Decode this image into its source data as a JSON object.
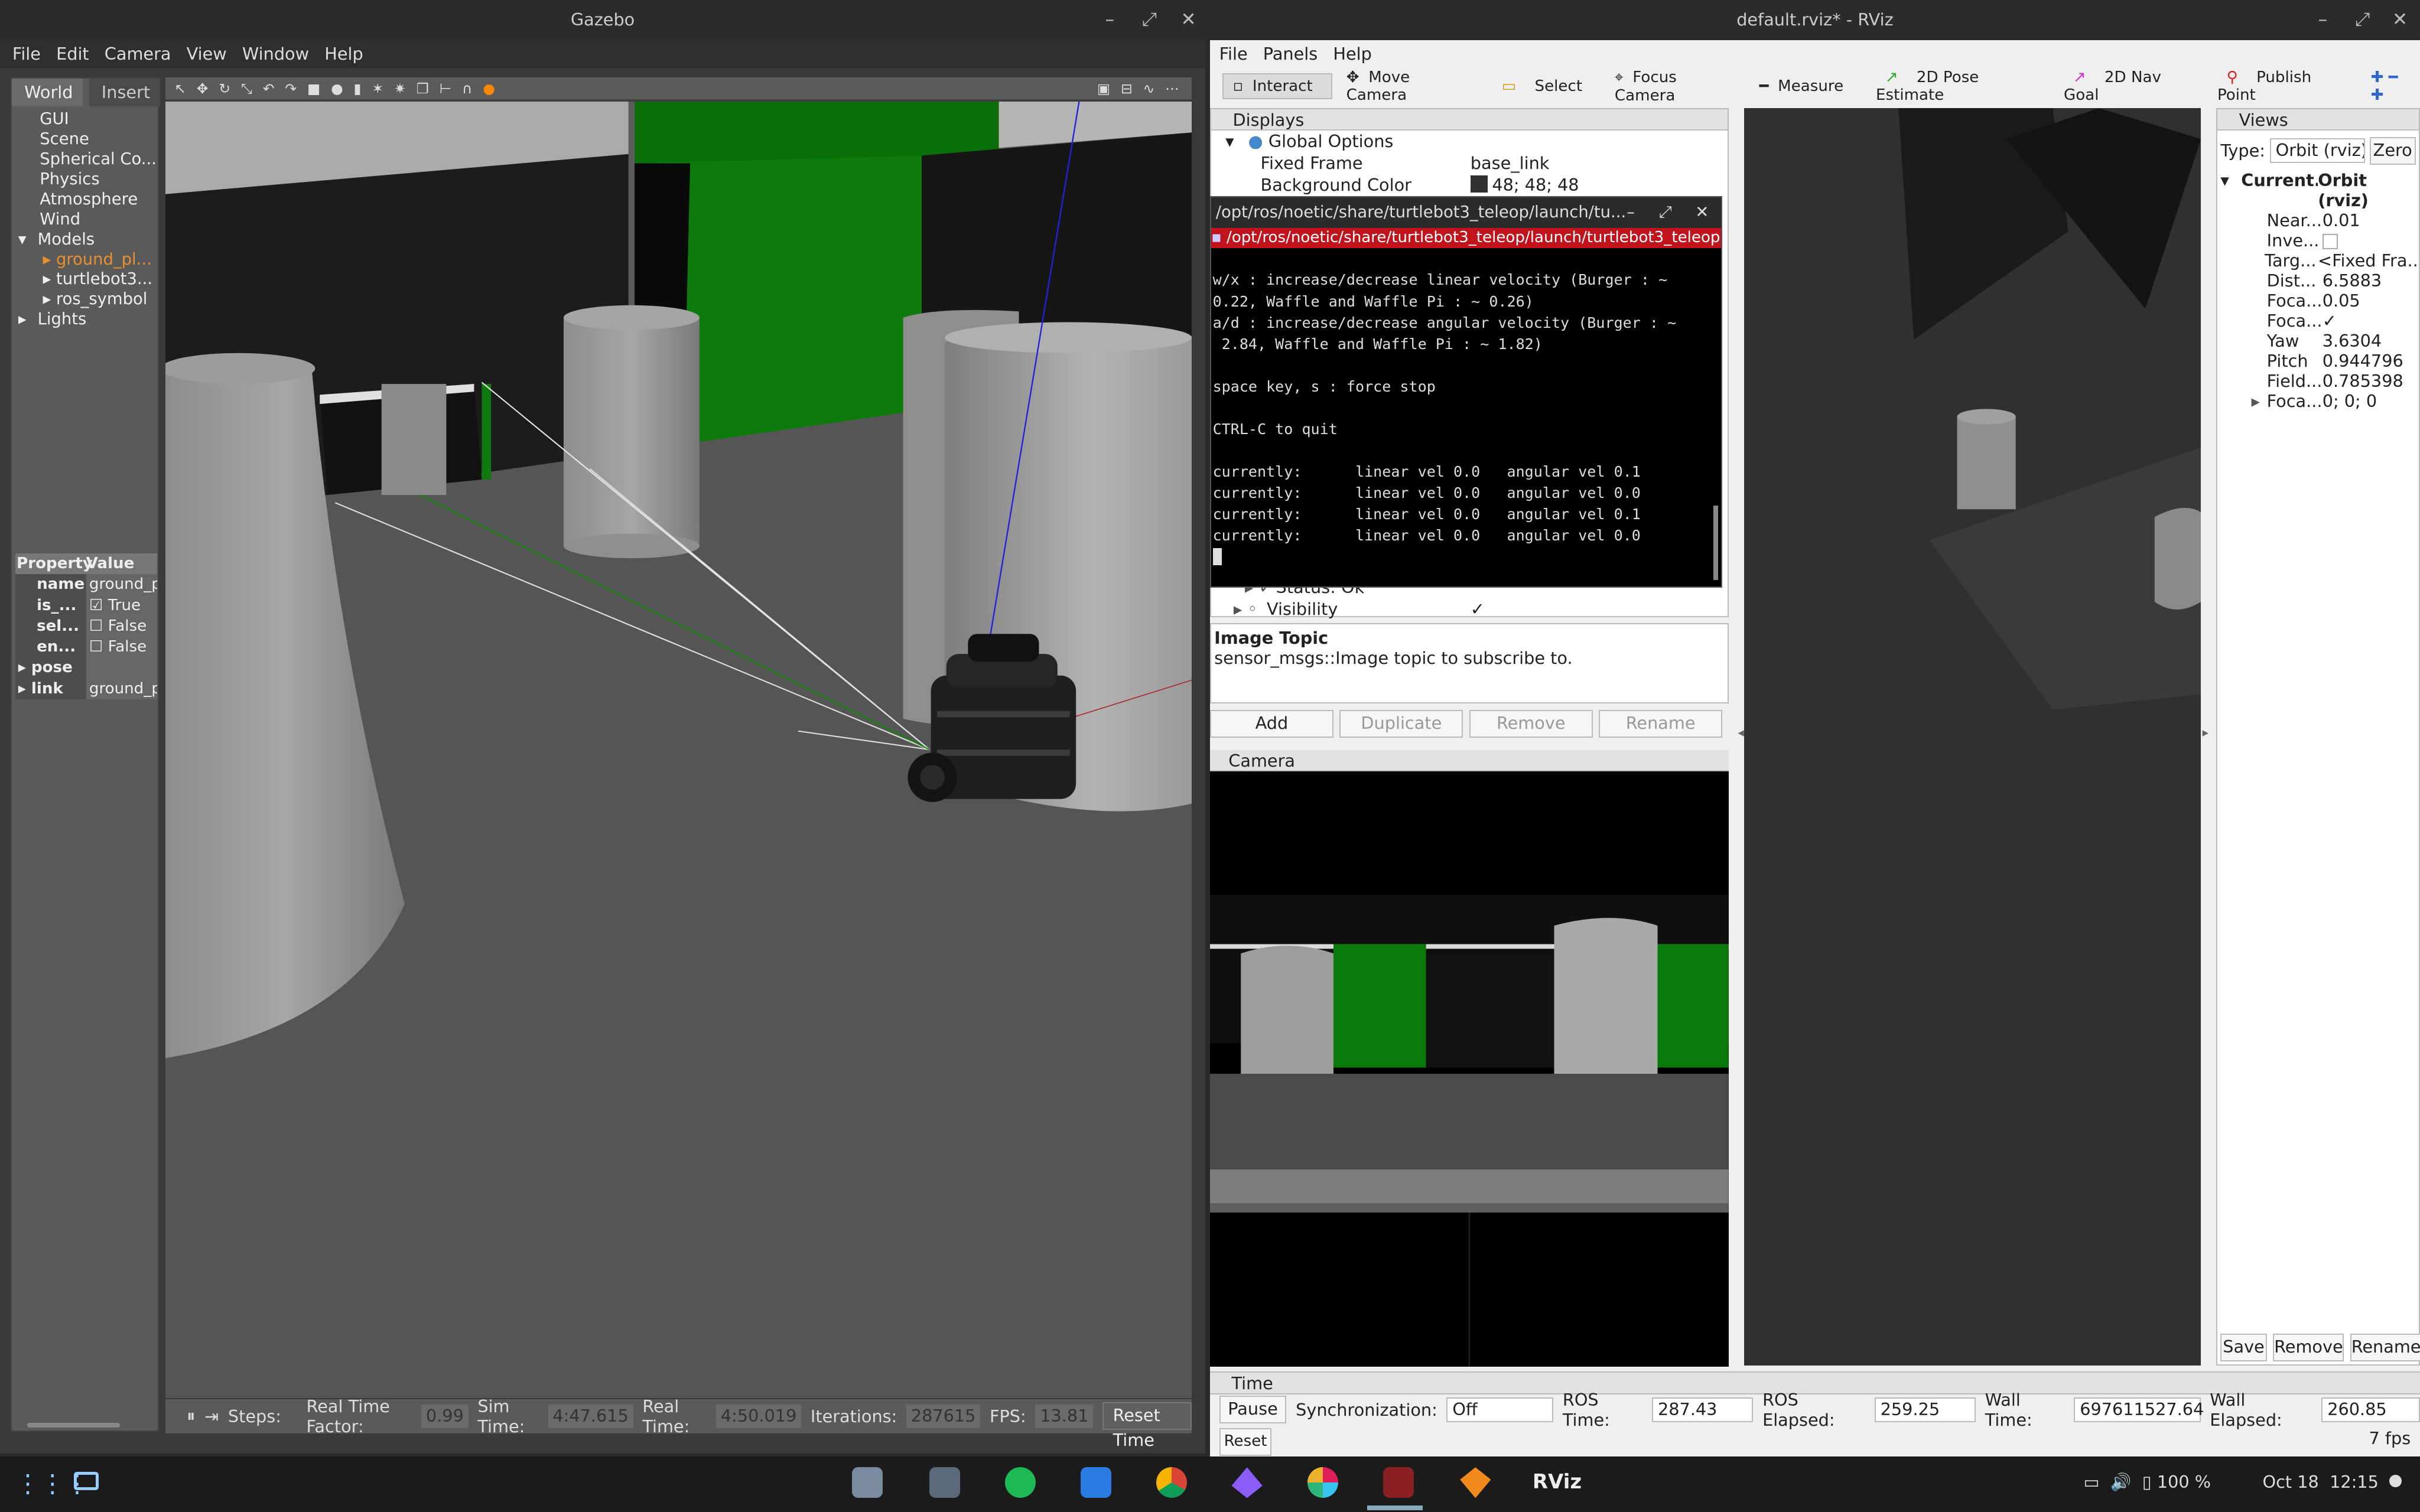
{
  "gazebo": {
    "title": "Gazebo",
    "menu": [
      "File",
      "Edit",
      "Camera",
      "View",
      "Window",
      "Help"
    ],
    "tabs": [
      "World",
      "Insert"
    ],
    "tree": {
      "gui": "GUI",
      "scene": "Scene",
      "spherical": "Spherical Co...",
      "physics": "Physics",
      "atmosphere": "Atmosphere",
      "wind": "Wind",
      "models": "Models",
      "model_items": [
        "ground_pl...",
        "turtlebot3...",
        "ros_symbol"
      ],
      "lights": "Lights"
    },
    "properties": {
      "header_property": "Property",
      "header_value": "Value",
      "rows": [
        {
          "key": "name",
          "value": "ground_p"
        },
        {
          "key": "is_...",
          "value": "True"
        },
        {
          "key": "sel...",
          "value": "False"
        },
        {
          "key": "en...",
          "value": "False"
        },
        {
          "key": "pose",
          "value": ""
        },
        {
          "key": "link",
          "value": "ground_p"
        }
      ]
    },
    "status": {
      "steps_label": "Steps:",
      "rtf_label": "Real Time Factor:",
      "rtf": "0.99",
      "sim_label": "Sim Time:",
      "sim": "4:47.615",
      "real_label": "Real Time:",
      "real": "4:50.019",
      "iter_label": "Iterations:",
      "iter": "287615",
      "fps_label": "FPS:",
      "fps": "13.81",
      "reset": "Reset Time"
    }
  },
  "rviz": {
    "title": "default.rviz* - RViz",
    "menu": [
      "File",
      "Panels",
      "Help"
    ],
    "tools": [
      "Interact",
      "Move Camera",
      "Select",
      "Focus Camera",
      "Measure",
      "2D Pose Estimate",
      "2D Nav Goal",
      "Publish Point"
    ],
    "displays": {
      "title": "Displays",
      "global": "Global Options",
      "fixed_frame_label": "Fixed Frame",
      "fixed_frame": "base_link",
      "bg_label": "Background Color",
      "bg": "48; 48; 48",
      "status_ok": "Status: Ok",
      "visibility": "Visibility",
      "visibility_check": "✓"
    },
    "help": {
      "title": "Image Topic",
      "text": "sensor_msgs::Image topic to subscribe to."
    },
    "buttons": {
      "add": "Add",
      "duplicate": "Duplicate",
      "remove": "Remove",
      "rename": "Rename"
    },
    "camera_title": "Camera",
    "views": {
      "title": "Views",
      "type_label": "Type:",
      "type": "Orbit (rviz)",
      "zero": "Zero",
      "current_key": "Current...",
      "current_val": "Orbit (rviz)",
      "rows": [
        {
          "k": "Near...",
          "v": "0.01"
        },
        {
          "k": "Inve...",
          "v": ""
        },
        {
          "k": "Targ...",
          "v": "<Fixed Fra..."
        },
        {
          "k": "Dist...",
          "v": "6.5883"
        },
        {
          "k": "Foca...",
          "v": "0.05"
        },
        {
          "k": "Foca...",
          "v": "✓"
        },
        {
          "k": "Yaw",
          "v": "3.6304"
        },
        {
          "k": "Pitch",
          "v": "0.944796"
        },
        {
          "k": "Field...",
          "v": "0.785398"
        },
        {
          "k": "Foca...",
          "v": "0; 0; 0"
        }
      ],
      "save": "Save",
      "remove": "Remove",
      "rename": "Rename"
    },
    "time": {
      "title": "Time",
      "pause": "Pause",
      "sync_label": "Synchronization:",
      "sync": "Off",
      "ros_time_label": "ROS Time:",
      "ros_time": "287.43",
      "ros_elapsed_label": "ROS Elapsed:",
      "ros_elapsed": "259.25",
      "wall_time_label": "Wall Time:",
      "wall_time": "697611527.64",
      "wall_elapsed_label": "Wall Elapsed:",
      "wall_elapsed": "260.85",
      "reset": "Reset",
      "fps": "7 fps"
    }
  },
  "terminal": {
    "title": "/opt/ros/noetic/share/turtlebot3_teleop/launch/tu...",
    "tab": "/opt/ros/noetic/share/turtlebot3_teleop/launch/turtlebot3_teleop",
    "lines": [
      "w/x : increase/decrease linear velocity (Burger : ~",
      "0.22, Waffle and Waffle Pi : ~ 0.26)",
      "a/d : increase/decrease angular velocity (Burger : ~",
      " 2.84, Waffle and Waffle Pi : ~ 1.82)",
      "",
      "space key, s : force stop",
      "",
      "CTRL-C to quit",
      "",
      "currently:      linear vel 0.0   angular vel 0.1",
      "currently:      linear vel 0.0   angular vel 0.0",
      "currently:      linear vel 0.0   angular vel 0.1",
      "currently:      linear vel 0.0   angular vel 0.0"
    ]
  },
  "taskbar": {
    "battery": "100 %",
    "date": "Oct 18",
    "time": "12:15",
    "rviz_label": "RViz"
  }
}
